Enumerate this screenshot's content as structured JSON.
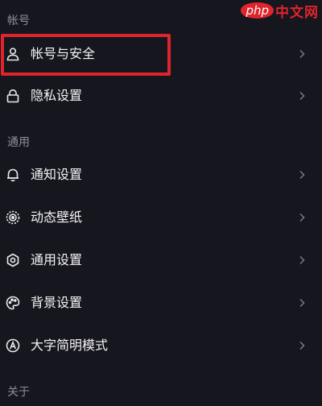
{
  "watermark": {
    "php": "php",
    "cn": "中文网"
  },
  "sections": {
    "account": {
      "title": "帐号"
    },
    "general": {
      "title": "通用"
    },
    "about": {
      "title": "关于"
    }
  },
  "items": {
    "account_security": {
      "label": "帐号与安全",
      "icon": "person-icon"
    },
    "privacy": {
      "label": "隐私设置",
      "icon": "lock-icon"
    },
    "notifications": {
      "label": "通知设置",
      "icon": "bell-icon"
    },
    "dynamic_wallpaper": {
      "label": "动态壁纸",
      "icon": "wallpaper-icon"
    },
    "general_settings": {
      "label": "通用设置",
      "icon": "gear-icon"
    },
    "background_settings": {
      "label": "背景设置",
      "icon": "palette-icon"
    },
    "large_text_mode": {
      "label": "大字简明模式",
      "icon": "font-size-icon"
    }
  },
  "colors": {
    "background": "#16161e",
    "highlight": "#e0242c",
    "section_text": "#8e8e96",
    "label_text": "#f4f4f6",
    "chevron": "#7a7a82"
  }
}
